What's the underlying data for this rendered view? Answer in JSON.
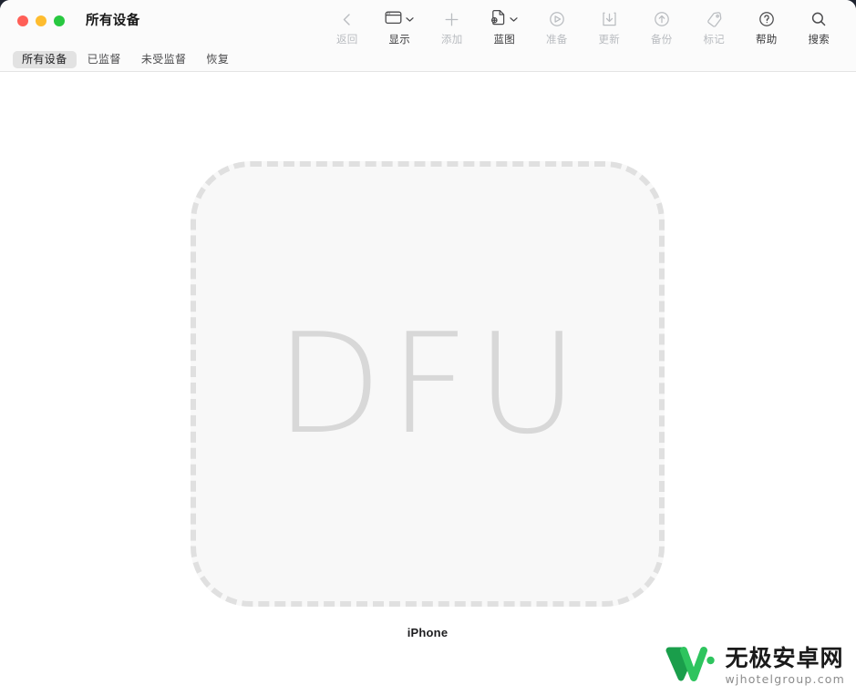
{
  "window": {
    "title": "所有设备",
    "traffic_lights": [
      {
        "name": "close",
        "color": "#ff5f57"
      },
      {
        "name": "minimize",
        "color": "#febc2e"
      },
      {
        "name": "maximize",
        "color": "#28c840"
      }
    ]
  },
  "toolbar": {
    "items": [
      {
        "label": "返回",
        "icon": "chevron-left-icon",
        "enabled": false,
        "has_chevron": false
      },
      {
        "label": "显示",
        "icon": "window-icon",
        "enabled": true,
        "has_chevron": true
      },
      {
        "label": "添加",
        "icon": "plus-icon",
        "enabled": false,
        "has_chevron": false
      },
      {
        "label": "蓝图",
        "icon": "blueprint-document-icon",
        "enabled": true,
        "has_chevron": true
      },
      {
        "label": "准备",
        "icon": "play-circle-icon",
        "enabled": false,
        "has_chevron": false
      },
      {
        "label": "更新",
        "icon": "download-box-icon",
        "enabled": false,
        "has_chevron": false
      },
      {
        "label": "备份",
        "icon": "arrow-up-circle-icon",
        "enabled": false,
        "has_chevron": false
      },
      {
        "label": "标记",
        "icon": "tag-icon",
        "enabled": false,
        "has_chevron": false
      },
      {
        "label": "帮助",
        "icon": "question-circle-icon",
        "enabled": true,
        "has_chevron": false
      },
      {
        "label": "搜索",
        "icon": "search-icon",
        "enabled": true,
        "has_chevron": false
      }
    ]
  },
  "tabs": [
    {
      "label": "所有设备",
      "selected": true
    },
    {
      "label": "已监督",
      "selected": false
    },
    {
      "label": "未受监督",
      "selected": false
    },
    {
      "label": "恢复",
      "selected": false
    }
  ],
  "main": {
    "device": {
      "state_text": "DFU",
      "name": "iPhone"
    }
  },
  "watermark": {
    "title": "无极安卓网",
    "subtitle": "wjhotelgroup.com",
    "logo_color_dark": "#1a9e4b",
    "logo_color_light": "#2ec45e"
  },
  "colors": {
    "toolbar_bg": "#fbfbfb",
    "content_bg": "#ffffff",
    "tile_bg": "#f8f8f8",
    "dash_border": "#e0e0e0",
    "dfu_text": "#d8d8d8",
    "tab_selected_bg": "#e2e2e2",
    "disabled_text": "#b9bcc0",
    "enabled_text": "#3a3a3c"
  }
}
